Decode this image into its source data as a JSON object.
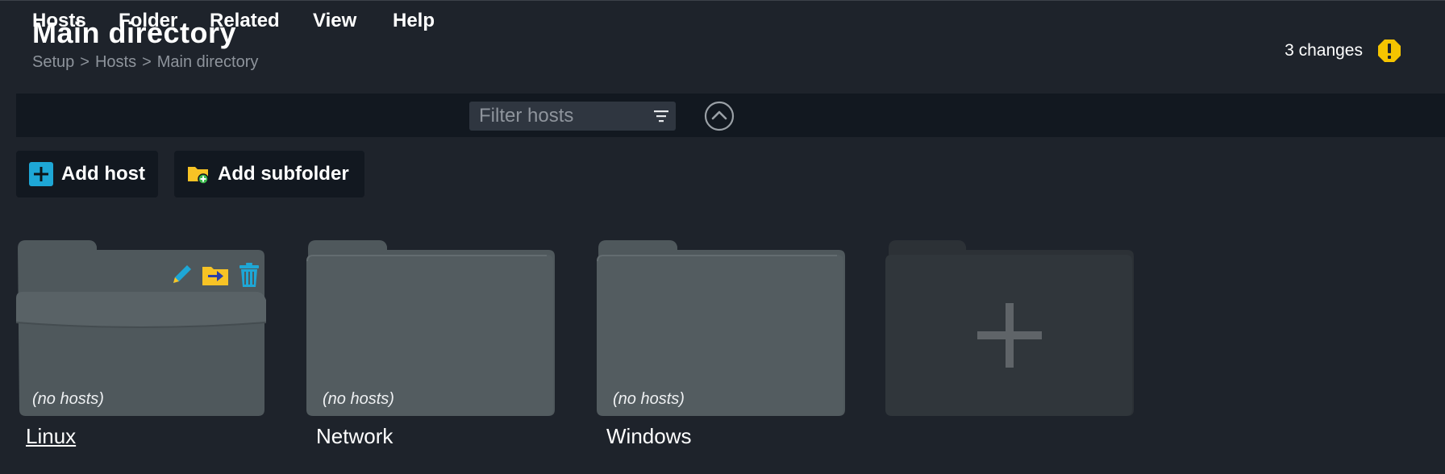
{
  "header": {
    "title": "Main directory",
    "breadcrumb": [
      "Setup",
      "Hosts",
      "Main directory"
    ],
    "breadcrumb_separator": ">",
    "changes_label": "3 changes",
    "changes_icon": "warning-icon",
    "changes_color": "#f5c400"
  },
  "menubar": {
    "items": [
      "Hosts",
      "Folder",
      "Related",
      "View",
      "Help"
    ],
    "filter_placeholder": "Filter hosts",
    "filter_icon": "filter-icon",
    "collapse_icon": "chevron-up-circle-icon"
  },
  "actions": {
    "add_host": "Add host",
    "add_subfolder": "Add subfolder"
  },
  "folders": [
    {
      "name": "Linux",
      "hosts_label": "(no hosts)",
      "hovered": true
    },
    {
      "name": "Network",
      "hosts_label": "(no hosts)",
      "hovered": false
    },
    {
      "name": "Windows",
      "hosts_label": "(no hosts)",
      "hovered": false
    }
  ],
  "colors": {
    "background": "#1e232b",
    "menubar": "#121820",
    "folder": "#535c60",
    "accent_blue": "#1ea7d6",
    "folder_yellow": "#f7c325"
  }
}
